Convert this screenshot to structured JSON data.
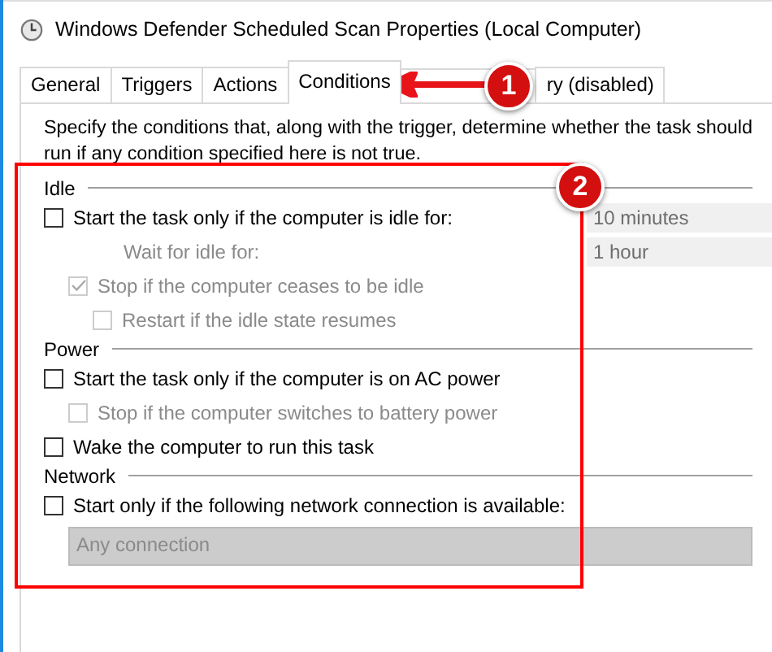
{
  "window": {
    "title": "Windows Defender Scheduled Scan Properties (Local Computer)"
  },
  "tabs": [
    {
      "label": "General",
      "selected": false
    },
    {
      "label": "Triggers",
      "selected": false
    },
    {
      "label": "Actions",
      "selected": false
    },
    {
      "label": "Conditions",
      "selected": true
    },
    {
      "selected": false
    },
    {
      "label": "ry (disabled)",
      "selected": false
    }
  ],
  "description": "Specify the conditions that, along with the trigger, determine whether the task should run  if any condition specified here is not true.",
  "sections": [
    {
      "title": "Idle",
      "items": [
        {
          "kind": "checkbox",
          "label": "Start the task only if the computer is idle for:",
          "checked": false,
          "disabled": false,
          "value": "10 minutes",
          "children": [
            {
              "kind": "label",
              "label": "Wait for idle for:",
              "disabled": true,
              "value": "1 hour"
            },
            {
              "kind": "checkbox",
              "label": "Stop if the computer ceases to be idle",
              "checked": true,
              "disabled": true,
              "children": [
                {
                  "kind": "checkbox",
                  "label": "Restart if the idle state resumes",
                  "checked": false,
                  "disabled": true
                }
              ]
            }
          ]
        }
      ]
    },
    {
      "title": "Power",
      "items": [
        {
          "kind": "checkbox",
          "label": "Start the task only if the computer is on AC power",
          "checked": false,
          "disabled": false,
          "children": [
            {
              "kind": "checkbox",
              "label": "Stop if the computer switches to battery power",
              "checked": false,
              "disabled": true
            }
          ]
        },
        {
          "kind": "checkbox",
          "label": "Wake the computer to run this task",
          "checked": false,
          "disabled": false
        }
      ]
    },
    {
      "title": "Network",
      "items": [
        {
          "kind": "checkbox",
          "label": "Start only if the following network connection is available:",
          "checked": false,
          "disabled": false,
          "children": [
            {
              "kind": "dropdown",
              "value": "Any connection",
              "disabled": true
            }
          ]
        }
      ]
    }
  ],
  "callouts": [
    "1",
    "2"
  ]
}
